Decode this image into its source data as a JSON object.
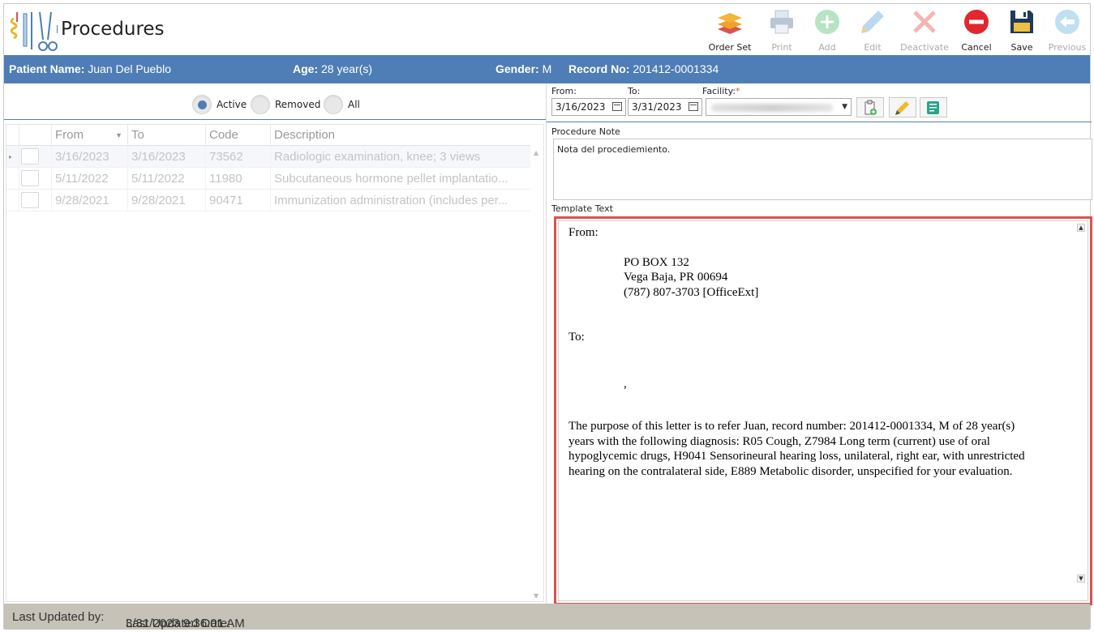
{
  "header": {
    "title": "Procedures",
    "toolbar": [
      {
        "name": "order-set-button",
        "label": "Order Set",
        "icon": "layers-icon",
        "enabled": true
      },
      {
        "name": "print-button",
        "label": "Print",
        "icon": "printer-icon",
        "enabled": false
      },
      {
        "name": "add-button",
        "label": "Add",
        "icon": "plus-icon",
        "enabled": false
      },
      {
        "name": "edit-button",
        "label": "Edit",
        "icon": "pencil-icon",
        "enabled": false
      },
      {
        "name": "deactivate-button",
        "label": "Deactivate",
        "icon": "x-icon",
        "enabled": false
      },
      {
        "name": "cancel-button",
        "label": "Cancel",
        "icon": "minus-circle-icon",
        "enabled": true
      },
      {
        "name": "save-button",
        "label": "Save",
        "icon": "floppy-icon",
        "enabled": true
      },
      {
        "name": "previous-button",
        "label": "Previous",
        "icon": "arrow-left-icon",
        "enabled": false
      }
    ]
  },
  "patient": {
    "name_label": "Patient Name:",
    "name": "Juan Del Pueblo",
    "age_label": "Age:",
    "age": "28 year(s)",
    "gender_label": "Gender:",
    "gender": "M",
    "record_label": "Record No:",
    "record": "201412-0001334"
  },
  "filter": {
    "options": [
      "Active",
      "Removed",
      "All"
    ],
    "selected": "Active"
  },
  "grid": {
    "columns": [
      "From",
      "To",
      "Code",
      "Description"
    ],
    "rows": [
      {
        "from": "3/16/2023",
        "to": "3/16/2023",
        "code": "73562",
        "description": "Radiologic examination, knee; 3 views"
      },
      {
        "from": "5/11/2022",
        "to": "5/11/2022",
        "code": "11980",
        "description": "Subcutaneous hormone pellet implantatio..."
      },
      {
        "from": "9/28/2021",
        "to": "9/28/2021",
        "code": "90471",
        "description": "Immunization administration (includes per..."
      }
    ]
  },
  "range": {
    "from_label": "From:",
    "from": "3/16/2023",
    "to_label": "To:",
    "to": "3/31/2023",
    "facility_label": "Facility:",
    "required_mark": "*"
  },
  "procedure_note": {
    "label": "Procedure Note",
    "text": "Nota del procediemiento."
  },
  "template": {
    "label": "Template Text",
    "from_label": "From:",
    "address_line1": "PO BOX 132",
    "address_line2": "Vega Baja, PR 00694",
    "address_line3": "(787) 807-3703 [OfficeExt]",
    "to_label": "To:",
    "comma": ",",
    "body_line1": "The purpose of this letter is to refer Juan,  record number: 201412-0001334,  M of 28 year(s)",
    "body_line2": "years with the following diagnosis: R05 Cough, Z7984 Long term (current) use of oral",
    "body_line3": "hypoglycemic drugs, H9041 Sensorineural hearing loss, unilateral, right ear, with unrestricted",
    "body_line4": "hearing on the contralateral side, E889 Metabolic disorder, unspecified  for your evaluation."
  },
  "footer": {
    "updated_by_label": "Last Updated by:",
    "updated_date_label": "Last Updated Date:",
    "updated_date": "3/31/2023 9:36:01 AM"
  },
  "colors": {
    "accent": "#4e7eb5",
    "highlight_border": "#d9534f",
    "footer_bg": "#c6c2b7"
  }
}
